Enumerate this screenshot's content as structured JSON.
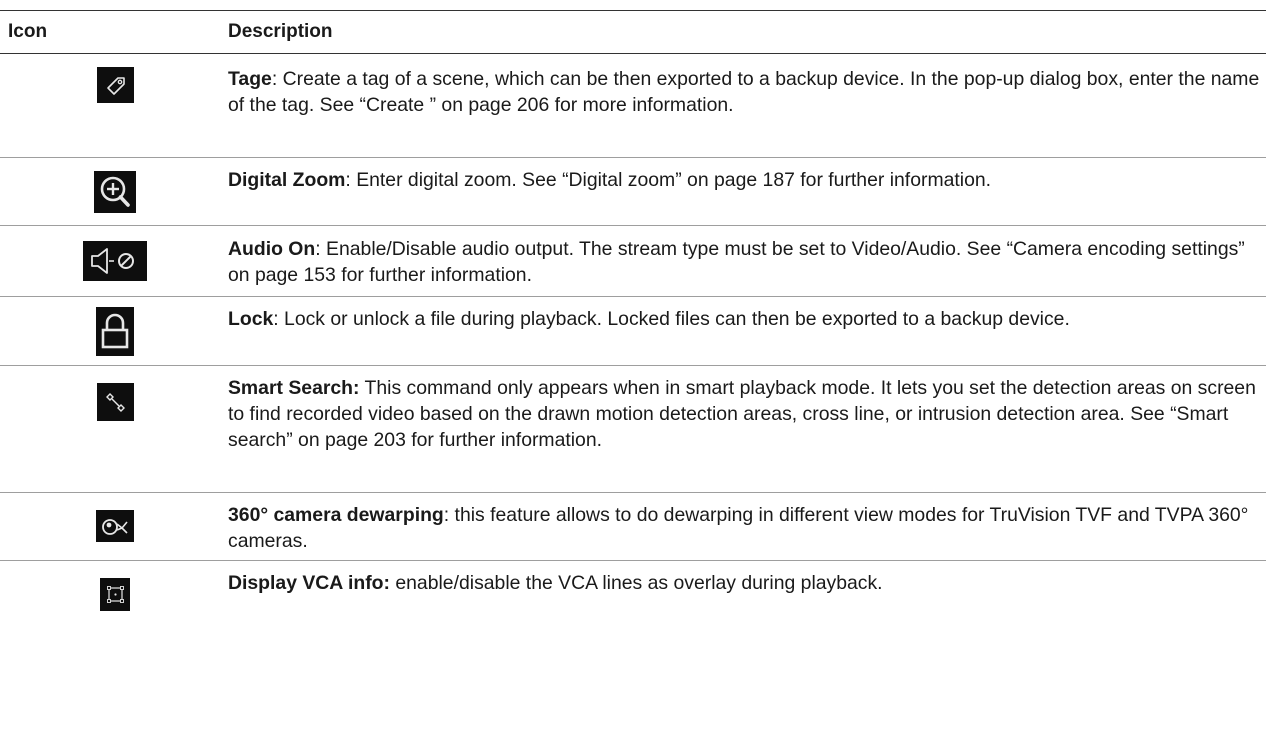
{
  "table": {
    "headers": {
      "icon": "Icon",
      "description": "Description"
    },
    "rows": [
      {
        "icon": "tag-icon",
        "title": "Tage",
        "sep": ":",
        "text": " Create a tag of a scene, which can be then exported to a backup device. In the pop-up dialog box, enter the name of the tag. See “Create ” on page 206 for more information."
      },
      {
        "icon": "digital-zoom-icon",
        "title": "Digital Zoom",
        "sep": ":",
        "text": " Enter digital zoom. See “Digital zoom” on page 187 for further information."
      },
      {
        "icon": "audio-mute-icon",
        "title": "Audio On",
        "sep": ":",
        "text": " Enable/Disable audio output. The stream type must be set to Video/Audio. See “Camera encoding settings” on page 153 for further information."
      },
      {
        "icon": "lock-icon",
        "title": "Lock",
        "sep": ":",
        "text": " Lock or unlock a file during playback. Locked files can then be exported to a backup device."
      },
      {
        "icon": "smart-search-icon",
        "title": "Smart Search:",
        "sep": "",
        "text": " This command only appears when in smart playback mode. It lets you set the detection areas on screen to find recorded video based on the drawn motion detection areas, cross line, or intrusion detection area. See “Smart search” on page 203 for further information."
      },
      {
        "icon": "dewarping-icon",
        "title": "360° camera dewarping",
        "sep": ":",
        "text": " this feature allows to do dewarping in different view modes for TruVision TVF and TVPA 360° cameras."
      },
      {
        "icon": "vca-info-icon",
        "title": "Display VCA info:",
        "sep": "",
        "text": " enable/disable the VCA lines as overlay during playback."
      }
    ]
  }
}
